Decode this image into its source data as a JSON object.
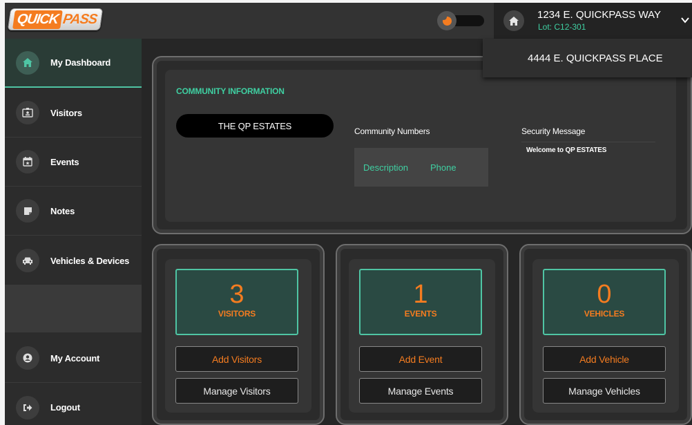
{
  "header": {
    "logo_quick": "QUICK",
    "logo_pass": "PASS",
    "address": "1234 E. QUICKPASS WAY",
    "lot": "Lot: C12-301",
    "dropdown_option": "4444 E. QUICKPASS PLACE",
    "icons": [
      "moon-icon",
      "home-icon",
      "chevron-down-icon"
    ]
  },
  "sidebar": {
    "items": [
      {
        "label": "My Dashboard",
        "icon": "home-icon",
        "active": true
      },
      {
        "label": "Visitors",
        "icon": "id-badge-icon"
      },
      {
        "label": "Events",
        "icon": "calendar-icon"
      },
      {
        "label": "Notes",
        "icon": "note-icon"
      },
      {
        "label": "Vehicles & Devices",
        "icon": "car-icon"
      },
      {
        "label": "My Account",
        "icon": "user-circle-icon"
      },
      {
        "label": "Logout",
        "icon": "logout-icon"
      }
    ]
  },
  "community": {
    "title": "COMMUNITY INFORMATION",
    "name": "THE QP ESTATES",
    "numbers_label": "Community Numbers",
    "col_description": "Description",
    "col_phone": "Phone",
    "security_label": "Security Message",
    "security_message": "Welcome to QP ESTATES"
  },
  "stats": {
    "visitors": {
      "count": "3",
      "label": "VISITORS",
      "add": "Add Visitors",
      "manage": "Manage Visitors"
    },
    "events": {
      "count": "1",
      "label": "EVENTS",
      "add": "Add Event",
      "manage": "Manage Events"
    },
    "vehicles": {
      "count": "0",
      "label": "VEHICLES",
      "add": "Add Vehicle",
      "manage": "Manage Vehicles"
    }
  },
  "colors": {
    "accent": "#f47c20",
    "teal": "#3fd0a2",
    "stat_bg": "#2a4a43"
  }
}
